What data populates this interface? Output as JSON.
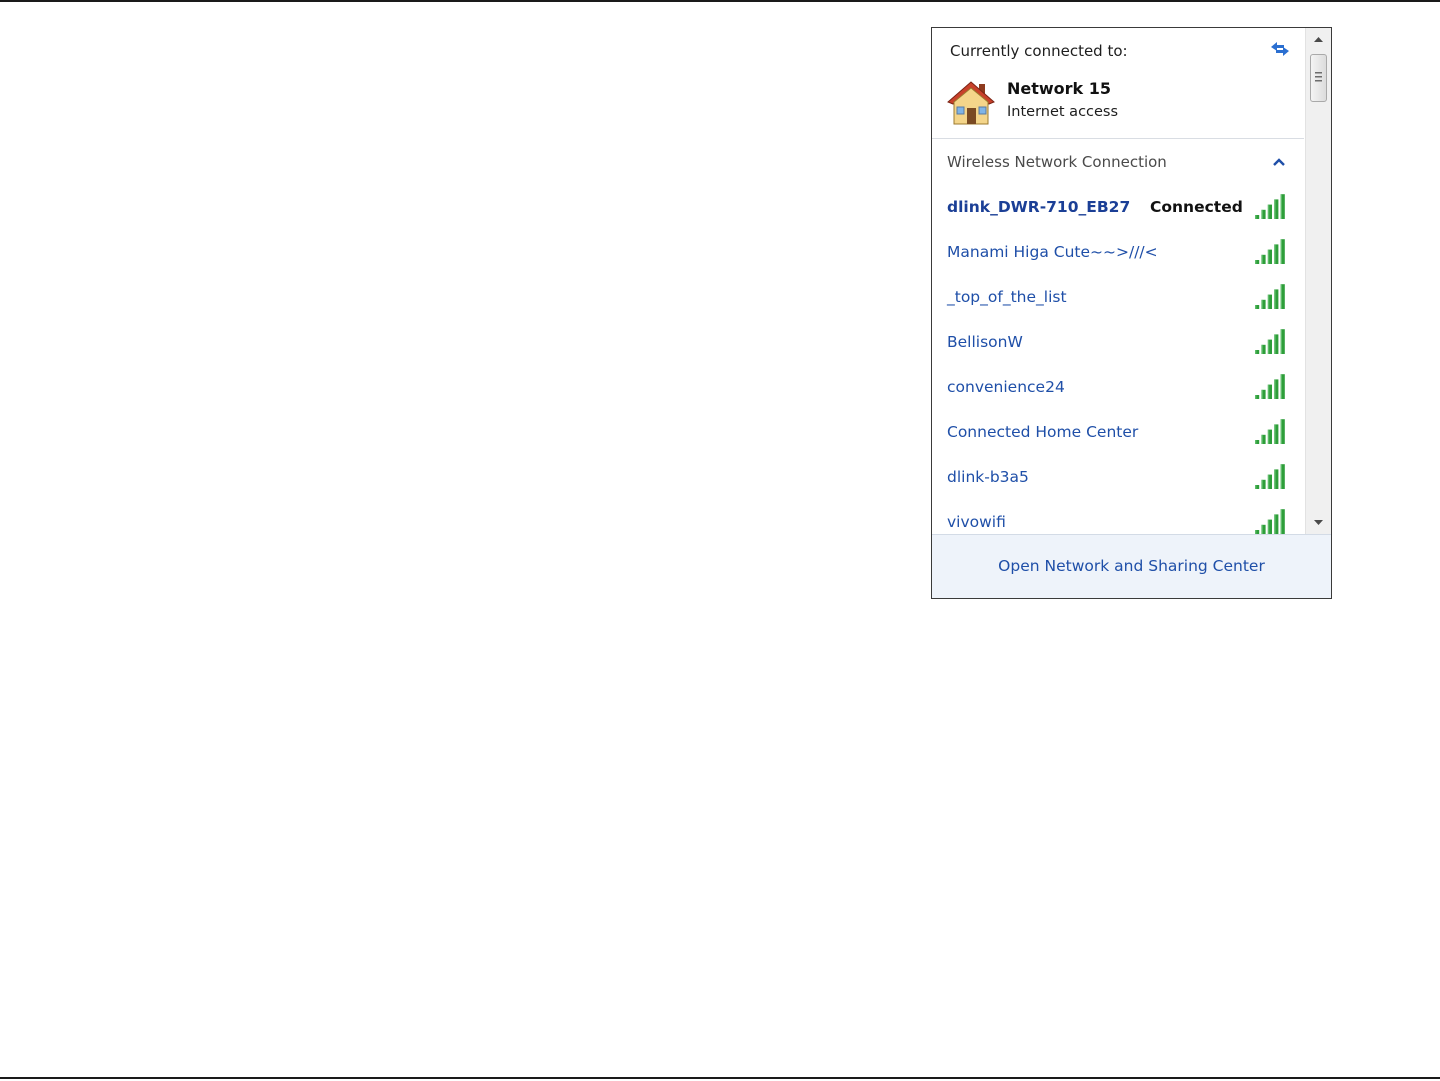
{
  "flyout": {
    "current_label": "Currently connected to:",
    "current_network": {
      "name": "Network  15",
      "status": "Internet access",
      "icon": "home-network-icon"
    },
    "refresh_icon": "refresh-icon",
    "section": {
      "title": "Wireless Network Connection",
      "toggle_icon": "chevron-up-icon"
    },
    "networks": [
      {
        "ssid": "dlink_DWR-710_EB27",
        "state": "Connected",
        "signal_bars": 5
      },
      {
        "ssid": "Manami Higa Cute~~>///<",
        "state": "",
        "signal_bars": 5
      },
      {
        "ssid": "_top_of_the_list",
        "state": "",
        "signal_bars": 5
      },
      {
        "ssid": "BellisonW",
        "state": "",
        "signal_bars": 5
      },
      {
        "ssid": "convenience24",
        "state": "",
        "signal_bars": 5
      },
      {
        "ssid": "Connected Home Center",
        "state": "",
        "signal_bars": 5
      },
      {
        "ssid": "dlink-b3a5",
        "state": "",
        "signal_bars": 5
      },
      {
        "ssid": "vivowifi",
        "state": "",
        "signal_bars": 5
      }
    ],
    "footer_link": "Open Network and Sharing Center",
    "colors": {
      "link": "#1f4fa8",
      "signal": "#2e9e3a",
      "footer_bg": "#eef3fa"
    }
  }
}
